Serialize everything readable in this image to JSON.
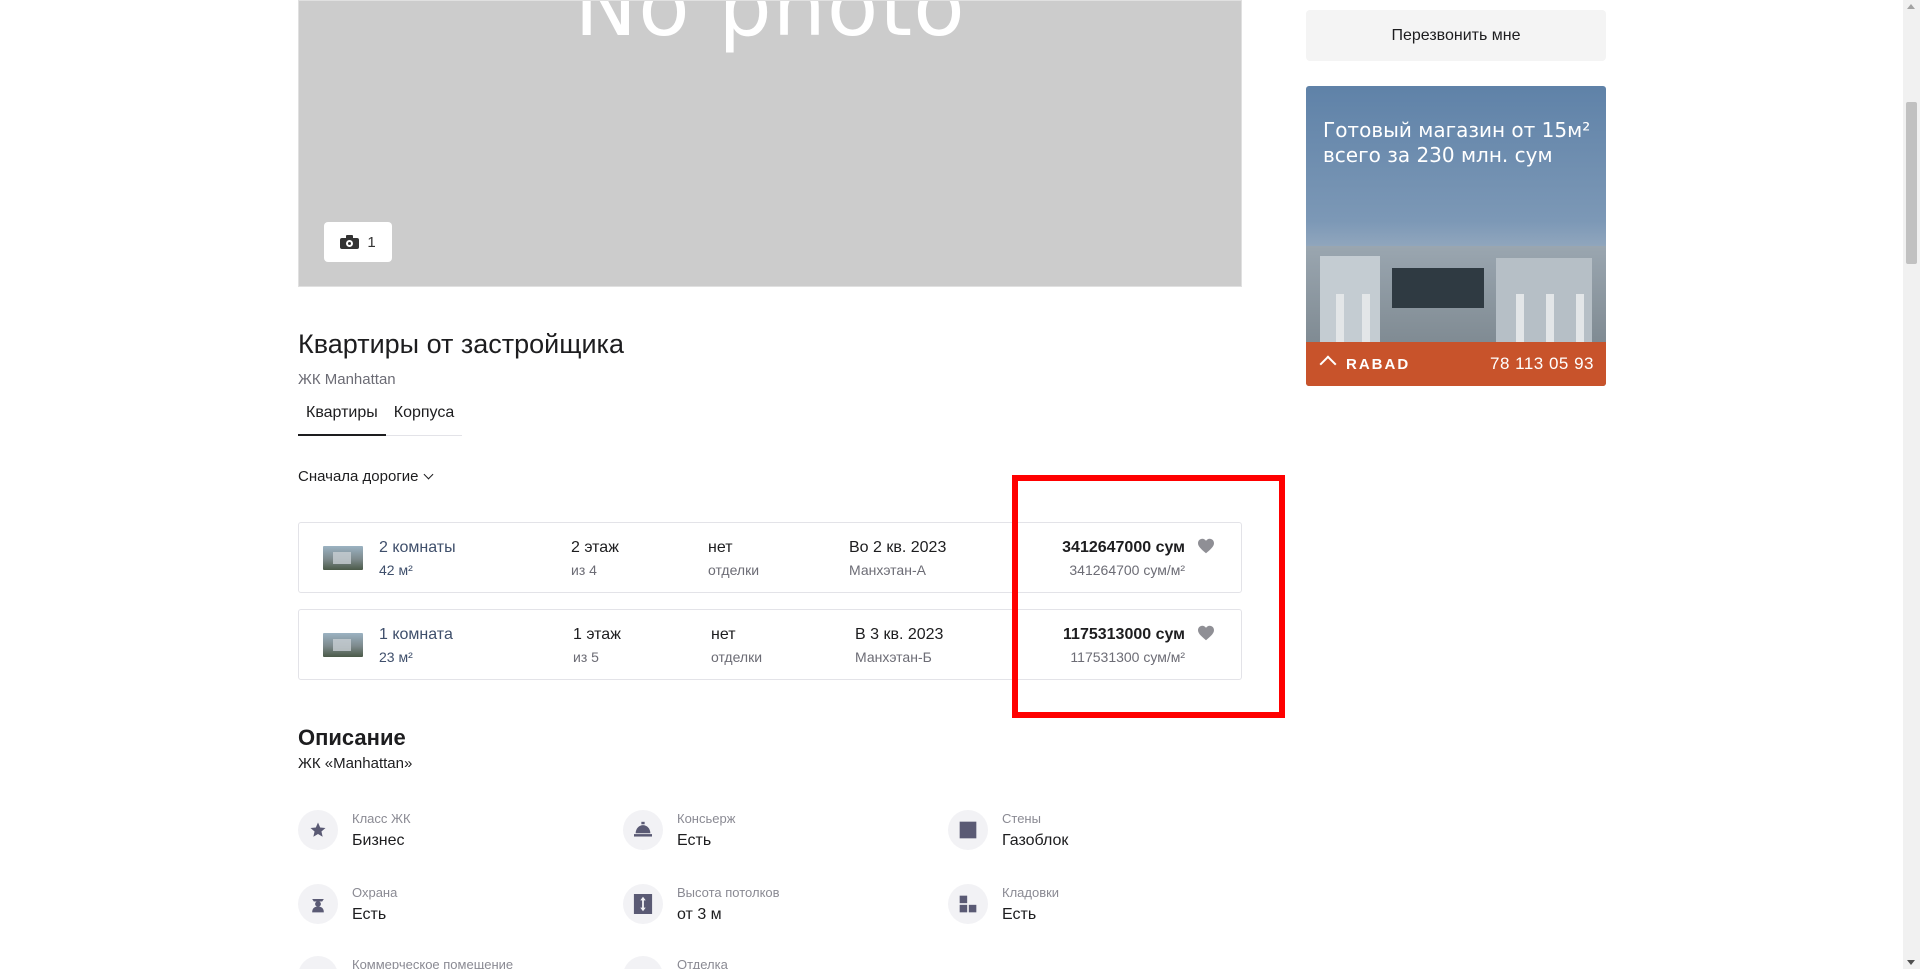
{
  "photo": {
    "placeholder_text": "No photo",
    "count": "1"
  },
  "developer_section": {
    "title": "Квартиры от застройщика",
    "subtitle": "ЖК Manhattan",
    "tabs": [
      {
        "label": "Квартиры",
        "active": true
      },
      {
        "label": "Корпуса",
        "active": false
      }
    ],
    "sort_label": "Сначала дорогие"
  },
  "listings": [
    {
      "rooms": "2 комнаты",
      "area": "42 м²",
      "floor": "2 этаж",
      "floor_of": "из 4",
      "finish": "нет",
      "finish_sub": "отделки",
      "completion": "Во 2 кв. 2023",
      "building": "Манхэтан-А",
      "price": "3412647000 сум",
      "price_per_m2": "341264700 сум/м²"
    },
    {
      "rooms": "1 комната",
      "area": "23 м²",
      "floor": "1 этаж",
      "floor_of": "из 5",
      "finish": "нет",
      "finish_sub": "отделки",
      "completion": "В 3 кв. 2023",
      "building": "Манхэтан-Б",
      "price": "1175313000 сум",
      "price_per_m2": "117531300 сум/м²"
    }
  ],
  "description": {
    "title": "Описание",
    "subtitle": "ЖК «Manhattan»",
    "features": [
      {
        "label": "Класс ЖК",
        "value": "Бизнес",
        "icon": "star-icon"
      },
      {
        "label": "Консьерж",
        "value": "Есть",
        "icon": "concierge-icon"
      },
      {
        "label": "Стены",
        "value": "Газоблок",
        "icon": "wall-icon"
      },
      {
        "label": "Охрана",
        "value": "Есть",
        "icon": "guard-icon"
      },
      {
        "label": "Высота потолков",
        "value": "от 3 м",
        "icon": "ceiling-height-icon"
      },
      {
        "label": "Кладовки",
        "value": "Есть",
        "icon": "storage-icon"
      },
      {
        "label": "Коммерческое помещение",
        "value": "",
        "icon": "commercial-icon"
      },
      {
        "label": "Отделка",
        "value": "",
        "icon": "finish-icon"
      }
    ]
  },
  "sidebar": {
    "callback_label": "Перезвонить мне",
    "ad": {
      "headline": "Готовый магазин от 15м² всего за 230 млн. сум",
      "brand": "RABAD",
      "phone": "78 113 05 93"
    }
  },
  "colors": {
    "highlight": "#ff0000",
    "ad_bar": "#c8532b",
    "accent_text": "#3f4f6b"
  }
}
